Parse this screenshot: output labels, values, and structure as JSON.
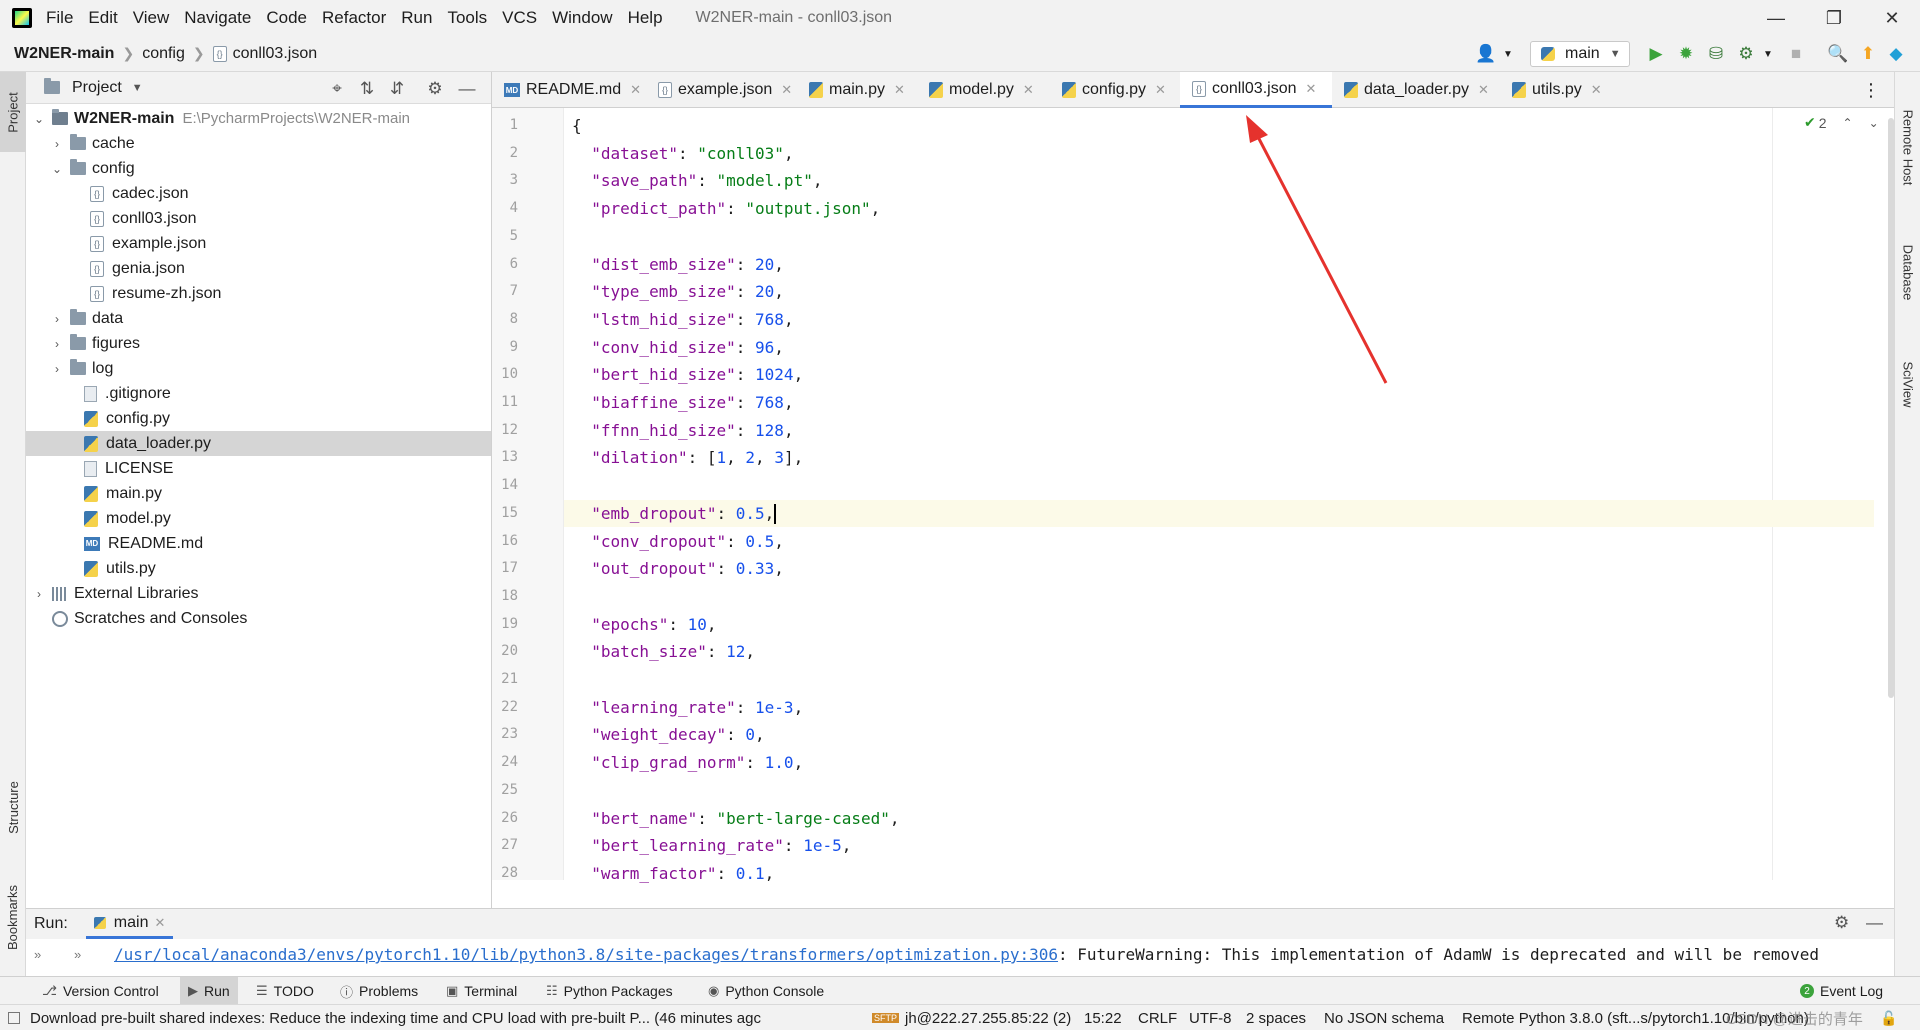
{
  "menubar": {
    "items": [
      "File",
      "Edit",
      "View",
      "Navigate",
      "Code",
      "Refactor",
      "Run",
      "Tools",
      "VCS",
      "Window",
      "Help"
    ],
    "window_title": "W2NER-main - conll03.json"
  },
  "navbar": {
    "crumbs": [
      "W2NER-main",
      "config",
      "conll03.json"
    ],
    "run_config": "main"
  },
  "left_strip": {
    "project_tab": "Project",
    "structure_tab": "Structure",
    "bookmarks_tab": "Bookmarks"
  },
  "right_strip": {
    "remote_host": "Remote Host",
    "database": "Database",
    "sciview": "SciView"
  },
  "project_panel": {
    "title": "Project",
    "root_name": "W2NER-main",
    "root_path": "E:\\PycharmProjects\\W2NER-main",
    "items": [
      "cache",
      "config",
      "cadec.json",
      "conll03.json",
      "example.json",
      "genia.json",
      "resume-zh.json",
      "data",
      "figures",
      "log",
      ".gitignore",
      "config.py",
      "data_loader.py",
      "LICENSE",
      "main.py",
      "model.py",
      "README.md",
      "utils.py",
      "External Libraries",
      "Scratches and Consoles"
    ]
  },
  "tabs": [
    "README.md",
    "example.json",
    "main.py",
    "model.py",
    "config.py",
    "conll03.json",
    "data_loader.py",
    "utils.py"
  ],
  "active_tab": "conll03.json",
  "editor": {
    "inspection_count": "2",
    "line_numbers": [
      "1",
      "2",
      "3",
      "4",
      "5",
      "6",
      "7",
      "8",
      "9",
      "10",
      "11",
      "12",
      "13",
      "14",
      "15",
      "16",
      "17",
      "18",
      "19",
      "20",
      "21",
      "22",
      "23",
      "24",
      "25",
      "26",
      "27",
      "28"
    ],
    "lines": [
      "{",
      "  \"dataset\": \"conll03\",",
      "  \"save_path\": \"model.pt\",",
      "  \"predict_path\": \"output.json\",",
      "",
      "  \"dist_emb_size\": 20,",
      "  \"type_emb_size\": 20,",
      "  \"lstm_hid_size\": 768,",
      "  \"conv_hid_size\": 96,",
      "  \"bert_hid_size\": 1024,",
      "  \"biaffine_size\": 768,",
      "  \"ffnn_hid_size\": 128,",
      "  \"dilation\": [1, 2, 3],",
      "",
      "  \"emb_dropout\": 0.5,",
      "  \"conv_dropout\": 0.5,",
      "  \"out_dropout\": 0.33,",
      "",
      "  \"epochs\": 10,",
      "  \"batch_size\": 12,",
      "",
      "  \"learning_rate\": 1e-3,",
      "  \"weight_decay\": 0,",
      "  \"clip_grad_norm\": 1.0,",
      "",
      "  \"bert_name\": \"bert-large-cased\",",
      "  \"bert_learning_rate\": 1e-5,",
      "  \"warm_factor\": 0.1,"
    ]
  },
  "run_panel": {
    "label": "Run:",
    "tab": "main",
    "console_link": "/usr/local/anaconda3/envs/pytorch1.10/lib/python3.8/site-packages/transformers/optimization.py:306",
    "console_text": ": FutureWarning: This implementation of AdamW is deprecated and will be removed"
  },
  "tool_tabs": [
    "Version Control",
    "Run",
    "TODO",
    "Problems",
    "Terminal",
    "Python Packages",
    "Python Console"
  ],
  "event_log": "Event Log",
  "event_log_count": "2",
  "status": {
    "message": "Download pre-built shared indexes: Reduce the indexing time and CPU load with pre-built P... (46 minutes agc",
    "sftp": "jh@222.27.255.85:22 (2)",
    "position": "15:22",
    "line_sep": "CRLF",
    "encoding": "UTF-8",
    "indent": "2 spaces",
    "schema": "No JSON schema",
    "interpreter": "Remote Python 3.8.0 (sft...s/pytorch1.10/bin/python)",
    "watermark": "CSDN @进击的青年"
  },
  "colors": {
    "accent": "#3875d7",
    "annotation_arrow": "#e5322d",
    "key": "#871094",
    "string": "#067d17",
    "number": "#1750eb"
  }
}
